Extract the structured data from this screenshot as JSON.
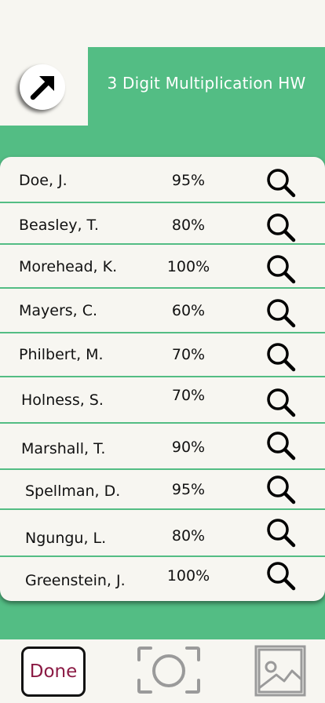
{
  "header": {
    "title": "3 Digit Multiplication HW",
    "back_icon": "arrow-up-left-icon"
  },
  "students": [
    {
      "name": "Doe, J.",
      "score": "95%"
    },
    {
      "name": "Beasley, T.",
      "score": "80%"
    },
    {
      "name": "Morehead, K.",
      "score": "100%"
    },
    {
      "name": "Mayers, C.",
      "score": "60%"
    },
    {
      "name": "Philbert, M.",
      "score": "70%"
    },
    {
      "name": "Holness, S.",
      "score": "70%"
    },
    {
      "name": "Marshall, T.",
      "score": "90%"
    },
    {
      "name": "Spellman, D.",
      "score": "95%"
    },
    {
      "name": "Ngungu, L.",
      "score": "80%"
    },
    {
      "name": "Greenstein, J.",
      "score": "100%"
    }
  ],
  "row_icon": "magnifier-icon",
  "footer": {
    "done_label": "Done",
    "camera_icon": "camera-frame-icon",
    "gallery_icon": "image-gallery-icon"
  },
  "colors": {
    "accent_green": "#53bd84",
    "background": "#f7f6f1",
    "done_text": "#8b1a44",
    "icon_gray": "#9a9a9a"
  }
}
